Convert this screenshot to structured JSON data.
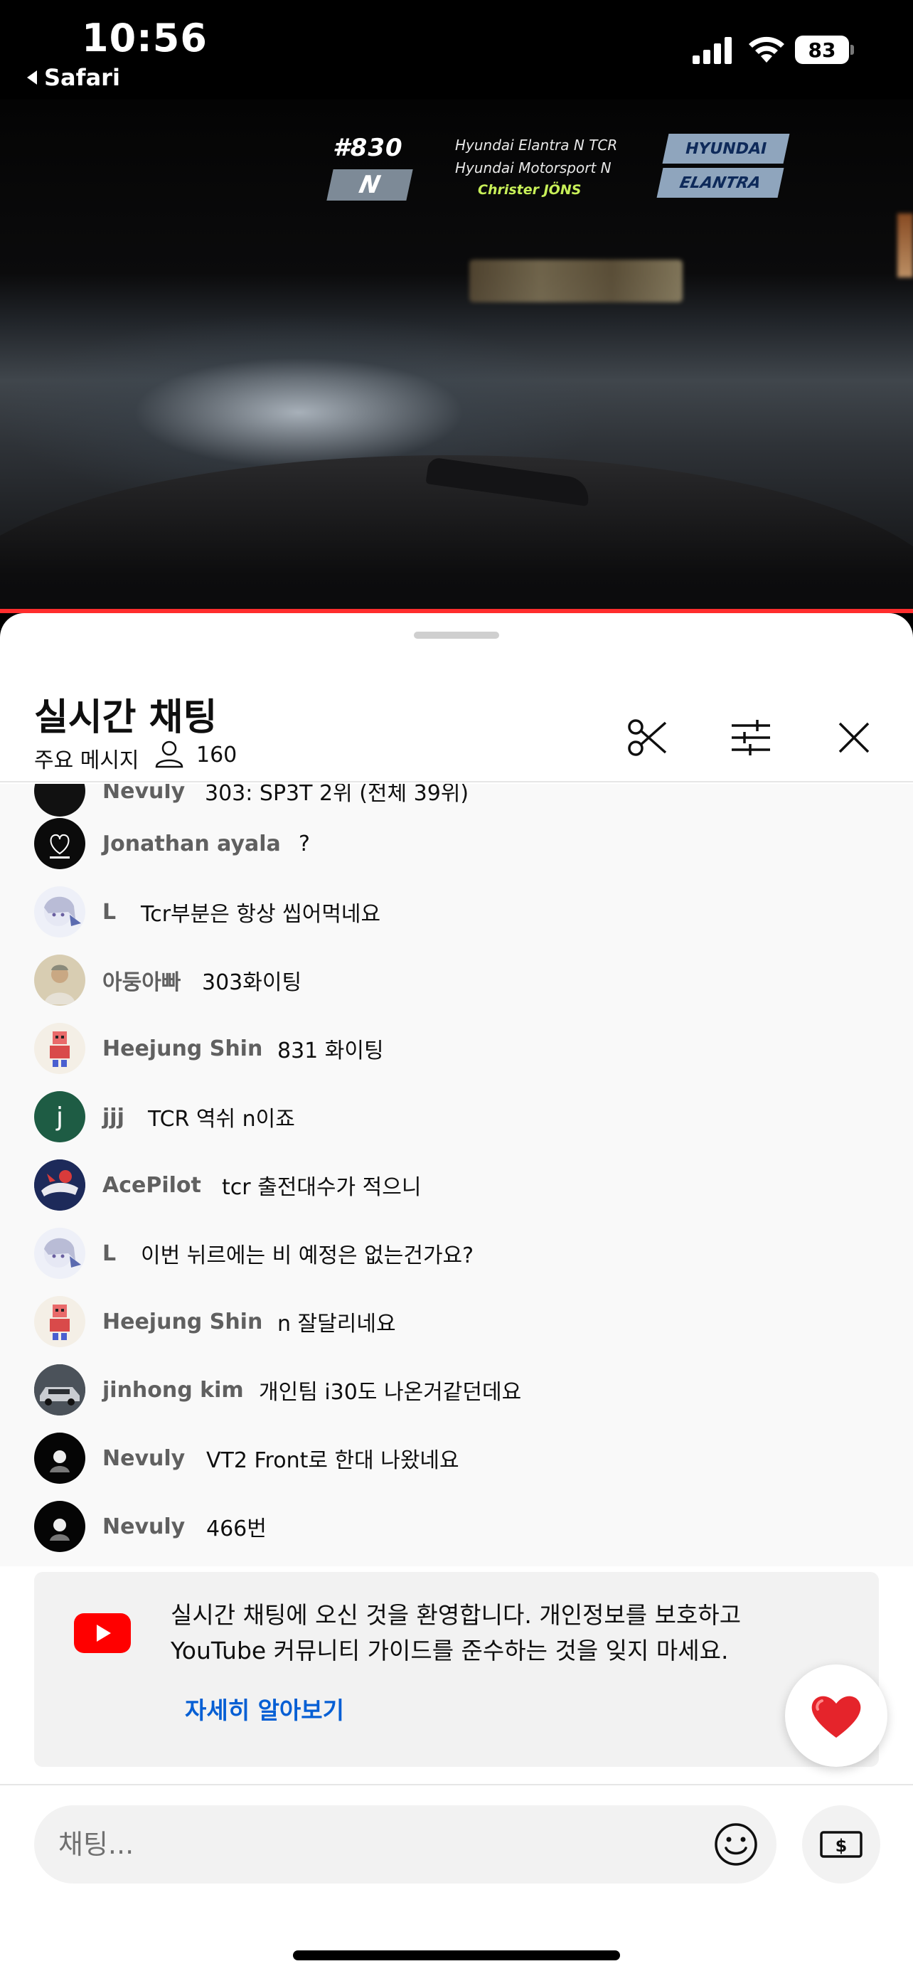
{
  "status_bar": {
    "time": "10:56",
    "back_app": "Safari",
    "battery": "83"
  },
  "video_overlay": {
    "car_number": "#830",
    "badge": "N",
    "car_model": "Hyundai Elantra N TCR",
    "team": "Hyundai Motorsport N",
    "driver": "Christer JÖNS",
    "brand_top": "HYUNDAI",
    "brand_bottom": "ELANTRA"
  },
  "header": {
    "title": "실시간 채팅",
    "subtitle": "주요 메시지",
    "viewer_count": "160",
    "icons": [
      "scissors-icon",
      "tune-icon",
      "close-icon"
    ]
  },
  "chat": {
    "partial_row": {
      "author": "Nevuly",
      "message": "303: SP3T 2위 (전체 39위)"
    },
    "messages": [
      {
        "author": "Jonathan ayala",
        "message": "?"
      },
      {
        "author": "L",
        "message": "Tcr부분은 항상 씹어먹네요"
      },
      {
        "author": "아둥아빠",
        "message": "303화이팅"
      },
      {
        "author": "Heejung Shin",
        "message": "831 화이팅"
      },
      {
        "author": "jjj",
        "message": "TCR 역쉬 n이죠",
        "avatar_letter": "j"
      },
      {
        "author": "AcePilot",
        "message": "tcr 출전대수가 적으니"
      },
      {
        "author": "L",
        "message": "이번 뉘르에는 비 예정은 없는건가요?"
      },
      {
        "author": "Heejung Shin",
        "message": "n 잘달리네요"
      },
      {
        "author": "jinhong kim",
        "message": "개인팀 i30도 나온거같던데요"
      },
      {
        "author": "Nevuly",
        "message": "VT2 Front로 한대 나왔네요"
      },
      {
        "author": "Nevuly",
        "message": "466번"
      }
    ]
  },
  "welcome": {
    "text": "실시간 채팅에 오신 것을 환영합니다. 개인정보를 보호하고 YouTube 커뮤니티 가이드를 준수하는 것을 잊지 마세요.",
    "link": "자세히 알아보기"
  },
  "input": {
    "placeholder": "채팅..."
  },
  "colors": {
    "progress": "#ff2d2d",
    "link": "#065fd4",
    "youtube_red": "#ff0000",
    "author_gray": "#606060"
  }
}
